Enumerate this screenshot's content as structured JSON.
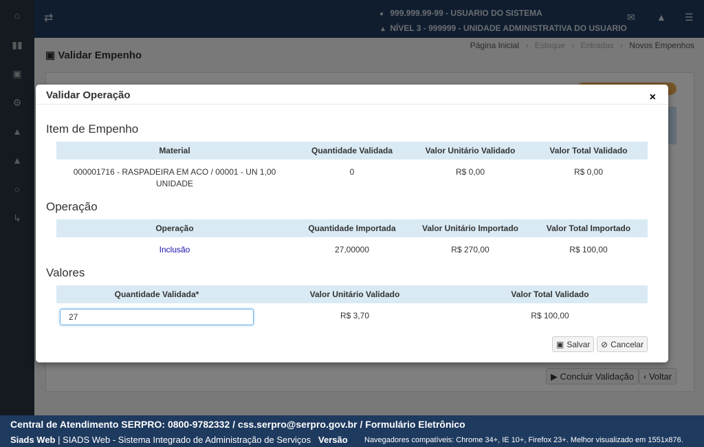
{
  "header": {
    "user_line": "999.999.99-99 - USUARIO DO SISTEMA",
    "unit_line": "NÍVEL 3 - 999999 - UNIDADE ADMINISTRATIVA DO USUARIO"
  },
  "page": {
    "title": "Validar Empenho",
    "breadcrumb": [
      "Página Inicial",
      "Estoque",
      "Entradas",
      "Novos Empenhos"
    ],
    "buttons": {
      "concluir": "Concluir Validação",
      "voltar": "Voltar"
    }
  },
  "modal": {
    "title": "Validar Operação",
    "close": "×",
    "item": {
      "title": "Item de Empenho",
      "headers": [
        "Material",
        "Quantidade Validada",
        "Valor Unitário Validado",
        "Valor Total Validado"
      ],
      "row": [
        "000001716 - RASPADEIRA EM ACO / 00001 - UN 1,00 UNIDADE",
        "0",
        "R$ 0,00",
        "R$ 0,00"
      ]
    },
    "operacao": {
      "title": "Operação",
      "headers": [
        "Operação",
        "Quantidade Importada",
        "Valor Unitário Importado",
        "Valor Total Importado"
      ],
      "row": [
        "Inclusão",
        "27,00000",
        "R$ 270,00",
        "R$ 100,00"
      ]
    },
    "valores": {
      "title": "Valores",
      "headers": [
        "Quantidade Validada*",
        "Valor Unitário Validado",
        "Valor Total Validado"
      ],
      "quantidade_value": "27",
      "row": [
        "R$ 3,70",
        "R$ 100,00"
      ]
    },
    "buttons": {
      "salvar": "Salvar",
      "cancelar": "Cancelar"
    }
  },
  "footer": {
    "line1": "Central de Atendimento SERPRO: 0800-9782332 / css.serpro@serpro.gov.br / Formulário Eletrônico",
    "brand": "Siads Web",
    "system": "SIADS Web - Sistema Integrado de Administração de Serviços",
    "version_label": "Versão",
    "compat": "Navegadores compatíveis: Chrome 34+, IE 10+, Firefox 23+. Melhor visualizado em 1551x876."
  },
  "colors": {
    "header_bg": "#1e3a5f",
    "sidebar_bg": "#2a3542",
    "table_header_bg": "#d9eaf4",
    "link": "#1a0dab"
  },
  "icons": [
    "home-icon",
    "barcode-icon",
    "archive-icon",
    "cogs-icon",
    "warning-icon",
    "graduation-icon",
    "circle-icon",
    "logout-icon",
    "exchange-icon",
    "envelope-icon",
    "bars-icon",
    "user-icon",
    "sitemap-icon",
    "money-icon",
    "save-icon",
    "ban-icon",
    "play-icon",
    "chevron-left-icon"
  ]
}
